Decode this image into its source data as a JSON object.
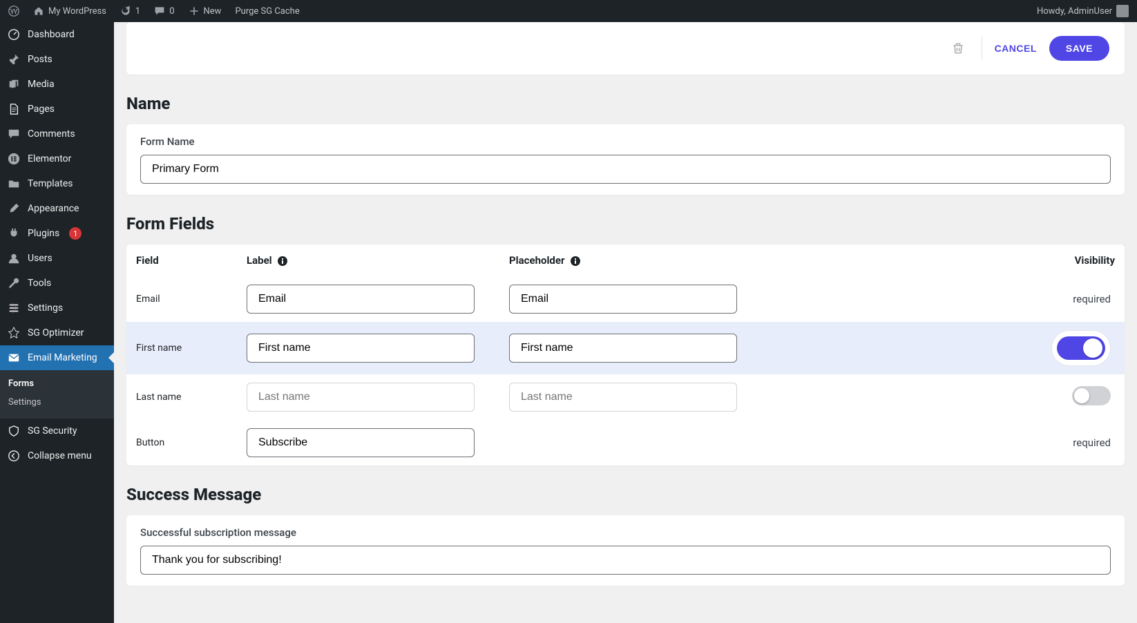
{
  "adminbar": {
    "site_name": "My WordPress",
    "updates_count": "1",
    "comments_count": "0",
    "new_label": "New",
    "purge_label": "Purge SG Cache",
    "howdy": "Howdy, AdminUser"
  },
  "sidebar": {
    "items": [
      {
        "label": "Dashboard",
        "icon": "dashboard"
      },
      {
        "label": "Posts",
        "icon": "pin"
      },
      {
        "label": "Media",
        "icon": "media"
      },
      {
        "label": "Pages",
        "icon": "pages"
      },
      {
        "label": "Comments",
        "icon": "comment"
      },
      {
        "label": "Elementor",
        "icon": "elementor"
      },
      {
        "label": "Templates",
        "icon": "folder"
      },
      {
        "label": "Appearance",
        "icon": "brush"
      },
      {
        "label": "Plugins",
        "icon": "plug",
        "badge": "1"
      },
      {
        "label": "Users",
        "icon": "user"
      },
      {
        "label": "Tools",
        "icon": "wrench"
      },
      {
        "label": "Settings",
        "icon": "sliders"
      },
      {
        "label": "SG Optimizer",
        "icon": "rocket"
      },
      {
        "label": "Email Marketing",
        "icon": "mail",
        "active": true
      },
      {
        "label": "SG Security",
        "icon": "shield"
      },
      {
        "label": "Collapse menu",
        "icon": "collapse"
      }
    ],
    "submenu": {
      "parent_index": 13,
      "items": [
        {
          "label": "Forms",
          "current": true
        },
        {
          "label": "Settings",
          "current": false
        }
      ]
    }
  },
  "actions": {
    "cancel": "CANCEL",
    "save": "SAVE"
  },
  "sections": {
    "name_title": "Name",
    "form_name_label": "Form Name",
    "form_name_value": "Primary Form",
    "fields_title": "Form Fields",
    "headers": {
      "field": "Field",
      "label": "Label",
      "placeholder": "Placeholder",
      "visibility": "Visibility"
    },
    "rows": [
      {
        "field": "Email",
        "label": "Email",
        "ph": "Email",
        "vis": "required",
        "highlight": false
      },
      {
        "field": "First name",
        "label": "First name",
        "ph": "First name",
        "vis": "toggle_on",
        "highlight": true
      },
      {
        "field": "Last name",
        "label": "",
        "ph": "",
        "label_ph": "Last name",
        "ph_ph": "Last name",
        "vis": "toggle_off",
        "highlight": false,
        "disabled": true
      },
      {
        "field": "Button",
        "label": "Subscribe",
        "ph": null,
        "vis": "required",
        "highlight": false
      }
    ],
    "required_text": "required",
    "success_title": "Success Message",
    "success_label": "Successful subscription message",
    "success_value": "Thank you for subscribing!"
  }
}
